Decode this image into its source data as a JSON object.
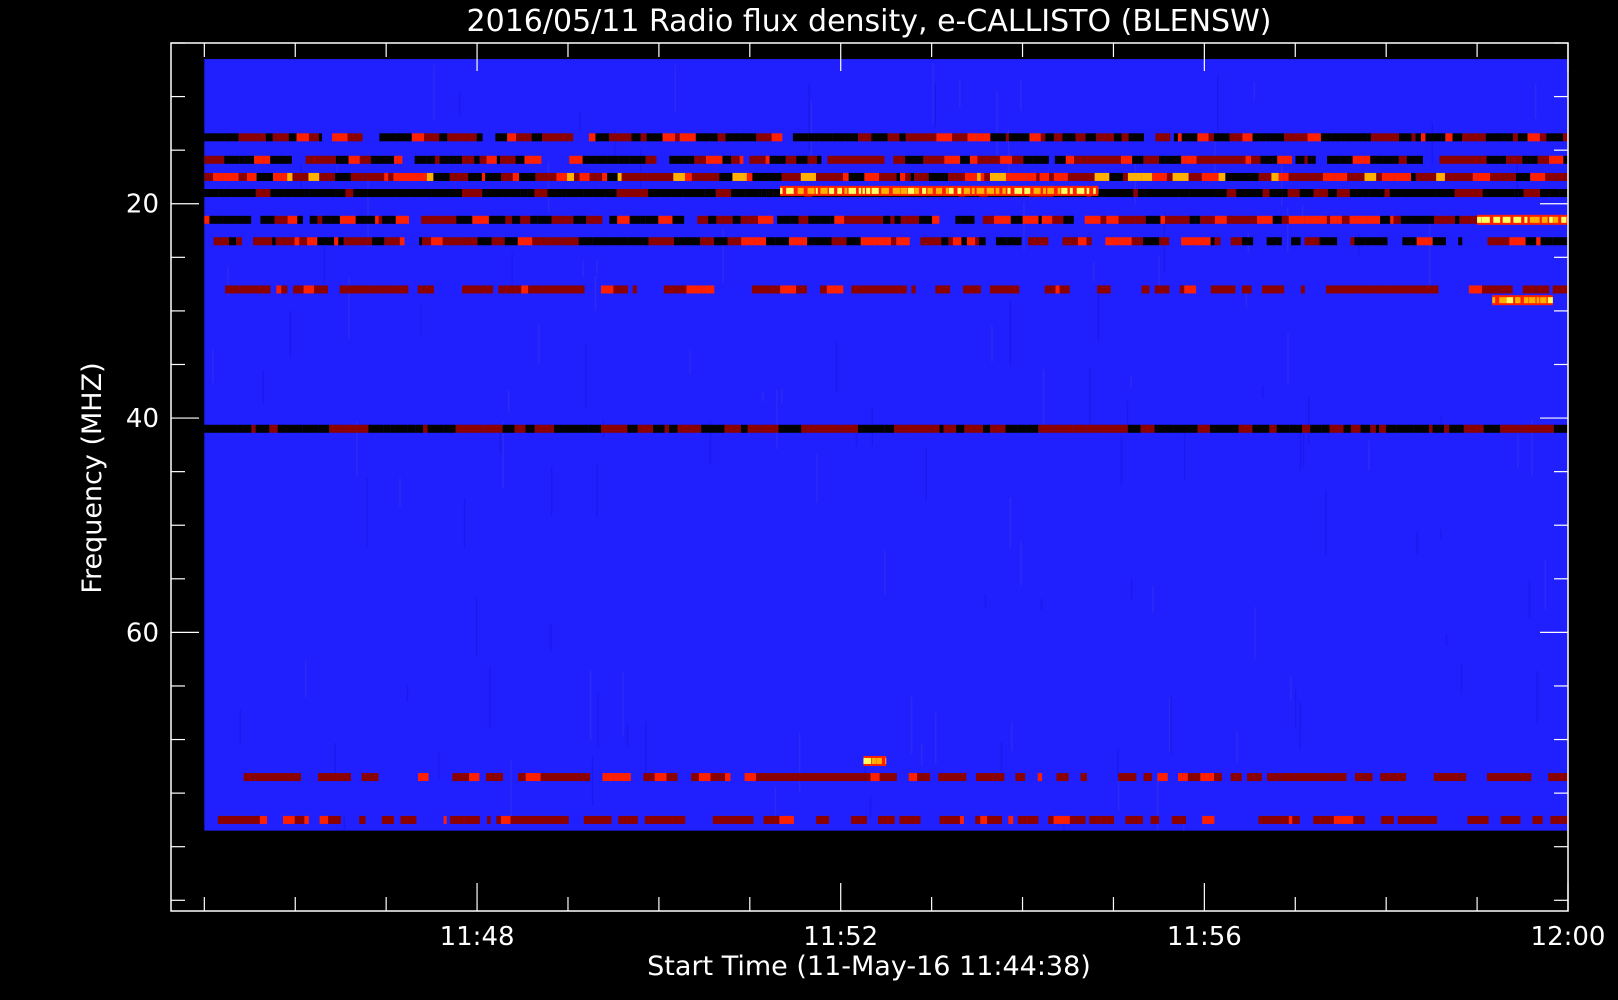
{
  "chart_data": {
    "type": "heatmap",
    "title": "2016/05/11  Radio flux density, e-CALLISTO (BLENSW)",
    "xlabel": "Start Time (11-May-16 11:44:38)",
    "ylabel": "Frequency (MHZ)",
    "xlim": [
      "11:44:38",
      "12:00:00"
    ],
    "ylim": [
      86,
      5
    ],
    "x_ticks": [
      "11:48",
      "11:52",
      "11:56",
      "12:00"
    ],
    "y_ticks": [
      20,
      40,
      60
    ],
    "y_minor_step": 5,
    "x_minor_step_minutes": 1,
    "colormap": [
      "#000000",
      "#8b0000",
      "#ff2000",
      "#ffb000",
      "#ffff60"
    ],
    "background_color": "#2020ff",
    "data_extent": {
      "x": [
        "11:45:00",
        "12:00:00"
      ],
      "y": [
        6.5,
        78.5
      ]
    },
    "bands": [
      {
        "freq": 13.8,
        "intensity": "mixed"
      },
      {
        "freq": 15.9,
        "intensity": "mixed"
      },
      {
        "freq": 17.5,
        "intensity": "bright"
      },
      {
        "freq": 19.0,
        "intensity": "dark"
      },
      {
        "freq": 21.5,
        "intensity": "mixed"
      },
      {
        "freq": 23.5,
        "intensity": "mixed"
      },
      {
        "freq": 28.0,
        "intensity": "moderate"
      },
      {
        "freq": 41.0,
        "intensity": "dark-red alternating"
      },
      {
        "freq": 73.5,
        "intensity": "moderate"
      },
      {
        "freq": 77.5,
        "intensity": "moderate"
      }
    ],
    "events": [
      {
        "start": "11:51:20",
        "end": "11:54:50",
        "freq": 18.8,
        "note": "bright burst"
      },
      {
        "start": "11:59:10",
        "end": "11:59:50",
        "freq": 29.0,
        "note": "bright burst"
      },
      {
        "start": "11:59:00",
        "end": "12:00:00",
        "freq": 21.5,
        "note": "bright burst"
      },
      {
        "start": "11:52:15",
        "end": "11:52:30",
        "freq": 72.0,
        "note": "small spot"
      }
    ]
  }
}
